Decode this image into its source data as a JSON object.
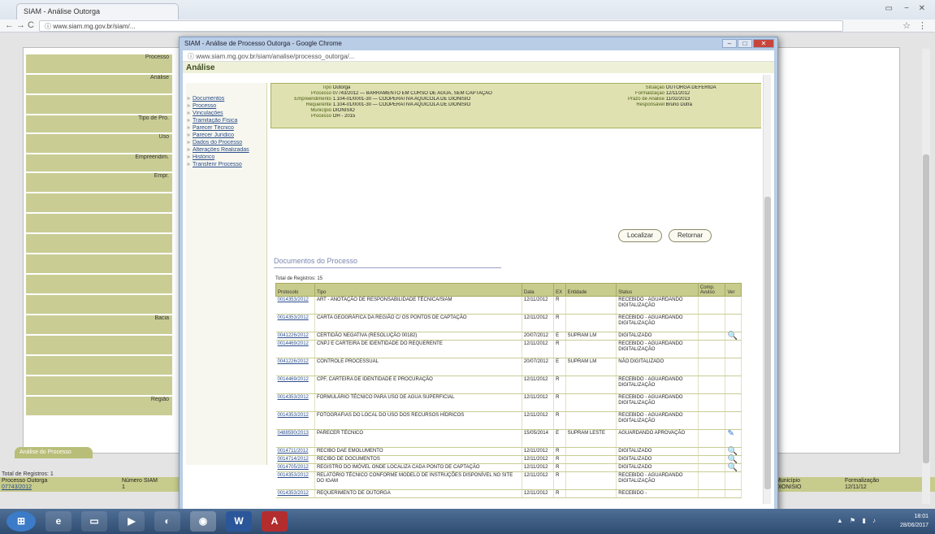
{
  "browser": {
    "tab_title": "SIAM - Análise Outorga",
    "url": "www.siam.mg.gov.br/siam/..."
  },
  "popup": {
    "title": "SIAM - Análise de Processo Outorga - Google Chrome",
    "url": "www.siam.mg.gov.br/siam/analise/processo_outorga/...",
    "heading": "Análise",
    "menu": [
      "Documentos",
      "Processo",
      "Vinculações",
      "Tramitação Física",
      "Parecer Técnico",
      "Parecer Jurídico",
      "Dados do Processo",
      "Alterações Realizadas",
      "Histórico",
      "Transferir Processo"
    ],
    "header": {
      "tipo_k": "Tipo",
      "tipo_v": "Outorga",
      "proc_k": "Processo",
      "proc_v": "07743/2012 — BARRAMENTO EM CURSO DE AGUA, SEM CAPTAÇÃO",
      "emp_k": "Empreendimento",
      "emp_v": "1.104-01/0001-30 — COOPERATIVA AQUICOLA DE DIONISIO",
      "req_k": "Requerente",
      "req_v": "1.104-01/0001-30 — COOPERATIVA AQUICOLA DE DIONISIO",
      "mun_k": "Município",
      "mun_v": "DIONISIO",
      "fase_k": "Processo",
      "fase_v": "OH - 2015",
      "sit_k": "Situação",
      "sit_v": "OUTORGA DEFERIDA",
      "form_k": "Formalização",
      "form_v": "12/11/2012",
      "prazo_k": "Prazo de Análise",
      "prazo_v": "11/02/2013",
      "resp_k": "Responsável",
      "resp_v": "Bruno Dutra"
    },
    "buttons": {
      "localizar": "Localizar",
      "retornar": "Retornar"
    },
    "section_title": "Documentos do Processo",
    "total": "Total de Registros: 15",
    "columns": [
      "Protocolo",
      "Tipo",
      "Data",
      "EX",
      "Entidade",
      "Status",
      "Comp. Avulso",
      "Ver"
    ],
    "rows": [
      {
        "p": "0014353/2012",
        "t": "ART - ANOTAÇÃO DE RESPONSABILIDADE TÉCNICA/SIAM",
        "d": "12/11/2012",
        "ex": "R",
        "e": "",
        "s": "RECEBIDO - AGUARDANDO DIGITALIZAÇÃO",
        "v": ""
      },
      {
        "p": "0014353/2012",
        "t": "CARTA GEOGRÁFICA DA REGIÃO C/ OS PONTOS DE CAPTAÇÃO",
        "d": "12/11/2012",
        "ex": "R",
        "e": "",
        "s": "RECEBIDO - AGUARDANDO DIGITALIZAÇÃO",
        "v": ""
      },
      {
        "p": "0041226/2012",
        "t": "CERTIDÃO NEGATIVA (RESOLUÇÃO 00182)",
        "d": "20/07/2012",
        "ex": "E",
        "e": "SUPRAM LM",
        "s": "DIGITALIZADO",
        "v": "🔍"
      },
      {
        "p": "0014469/2012",
        "t": "CNPJ E CARTEIRA DE IDENTIDADE DO REQUERENTE",
        "d": "12/11/2012",
        "ex": "R",
        "e": "",
        "s": "RECEBIDO - AGUARDANDO DIGITALIZAÇÃO",
        "v": ""
      },
      {
        "p": "0041226/2012",
        "t": "CONTROLE PROCESSUAL",
        "d": "20/07/2012",
        "ex": "E",
        "e": "SUPRAM LM",
        "s": "NÃO DIGITALIZADO",
        "v": ""
      },
      {
        "p": "0014469/2012",
        "t": "CPF, CARTEIRA DE IDENTIDADE E PROCURAÇÃO",
        "d": "12/11/2012",
        "ex": "R",
        "e": "",
        "s": "RECEBIDO - AGUARDANDO DIGITALIZAÇÃO",
        "v": ""
      },
      {
        "p": "0014353/2012",
        "t": "FORMULÁRIO TÉCNICO PARA USO DE AGUA SUPERFICIAL",
        "d": "12/11/2012",
        "ex": "R",
        "e": "",
        "s": "RECEBIDO - AGUARDANDO DIGITALIZAÇÃO",
        "v": ""
      },
      {
        "p": "0014353/2012",
        "t": "FOTOGRAFIAS DO LOCAL DO USO DOS RECURSOS HÍDRICOS",
        "d": "12/11/2012",
        "ex": "R",
        "e": "",
        "s": "RECEBIDO - AGUARDANDO DIGITALIZAÇÃO",
        "v": ""
      },
      {
        "p": "0488590/2013",
        "t": "PARECER TÉCNICO",
        "d": "15/05/2014",
        "ex": "E",
        "e": "SUPRAM LESTE",
        "s": "AGUARDANDO APROVAÇÃO",
        "v": "✎"
      },
      {
        "p": "0014711/2012",
        "t": "RECIBO DAE EMOLUMENTO",
        "d": "12/11/2012",
        "ex": "R",
        "e": "",
        "s": "DIGITALIZADO",
        "v": "🔍"
      },
      {
        "p": "0014714/2012",
        "t": "RECIBO DE DOCUMENTOS",
        "d": "12/11/2012",
        "ex": "R",
        "e": "",
        "s": "DIGITALIZADO",
        "v": "🔍"
      },
      {
        "p": "0014705/2012",
        "t": "REGISTRO DO IMÓVEL ONDE LOCALIZA CADA PONTO DE CAPTAÇÃO",
        "d": "12/11/2012",
        "ex": "R",
        "e": "",
        "s": "DIGITALIZADO",
        "v": "🔍"
      },
      {
        "p": "0014353/2012",
        "t": "RELATÓRIO TÉCNICO CONFORME MODELO DE INSTRUÇÕES DISPONÍVEL NO SITE DO IGAM",
        "d": "12/11/2012",
        "ex": "R",
        "e": "",
        "s": "RECEBIDO - AGUARDANDO DIGITALIZAÇÃO",
        "v": ""
      },
      {
        "p": "0014353/2012",
        "t": "REQUERIMENTO DE OUTORGA",
        "d": "12/11/2012",
        "ex": "R",
        "e": "",
        "s": "RECEBIDO -",
        "v": ""
      }
    ]
  },
  "background": {
    "labels": [
      "Processo",
      "Análise",
      "",
      "Tipo de Pro.",
      "Uso",
      "Empreendim.",
      "Empr.",
      "",
      "",
      "",
      "",
      "",
      "",
      "Bacia",
      "",
      "",
      "",
      "Região"
    ],
    "tab_button": "Análise do Processo",
    "total": "Total de Registros: 1",
    "col1": "Processo Outorga",
    "col2": "Número SIAM",
    "val1": "07743/2012",
    "val2": "1",
    "col3": "Município",
    "col4": "Formalização",
    "val3": "DIONISIO",
    "val4": "12/11/12"
  },
  "taskbar": {
    "time": "18:01",
    "date": "28/06/2017"
  }
}
